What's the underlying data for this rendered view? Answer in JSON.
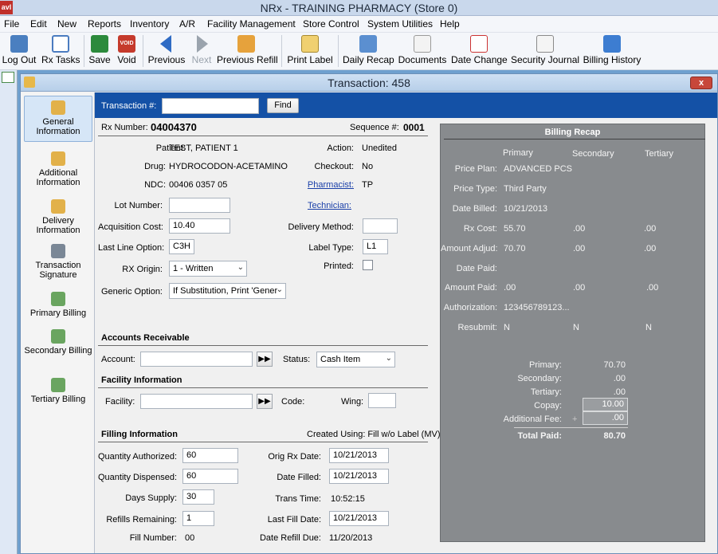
{
  "app": {
    "icon_text": "avl",
    "title": "NRx - TRAINING PHARMACY (Store 0)"
  },
  "menu": [
    "File",
    "Edit",
    "New",
    "Reports",
    "Inventory",
    "A/R",
    "Facility Management",
    "Store Control",
    "System Utilities",
    "Help"
  ],
  "toolbar": {
    "logout": "Log Out",
    "rxtasks": "Rx Tasks",
    "save": "Save",
    "void": "Void",
    "previous": "Previous",
    "next": "Next",
    "previous_refill": "Previous Refill",
    "print_label": "Print Label",
    "daily_recap": "Daily Recap",
    "documents": "Documents",
    "date_change": "Date Change",
    "security_journal": "Security Journal",
    "billing_history": "Billing History",
    "void_icon_text": "VOID"
  },
  "window": {
    "title": "Transaction: 458",
    "close": "x"
  },
  "nav": {
    "general": "General Information",
    "additional": "Additional Information",
    "delivery": "Delivery Information",
    "signature": "Transaction Signature",
    "primary": "Primary Billing",
    "secondary": "Secondary Billing",
    "tertiary": "Tertiary Billing"
  },
  "search": {
    "label": "Transaction #:",
    "value": "",
    "find": "Find"
  },
  "rx": {
    "number_label": "Rx Number:",
    "number": "04004370",
    "sequence_label": "Sequence #:",
    "sequence": "0001",
    "patient_label": "Patient:",
    "patient": "TEST, PATIENT 1",
    "drug_label": "Drug:",
    "drug": "HYDROCODON-ACETAMINO",
    "ndc_label": "NDC:",
    "ndc": "00406 0357 05",
    "lot_label": "Lot Number:",
    "lot": "",
    "acq_label": "Acquisition Cost:",
    "acq": "10.40",
    "lastline_label": "Last Line Option:",
    "lastline": "C3H",
    "origin_label": "RX Origin:",
    "origin": "1 - Written",
    "generic_label": "Generic Option:",
    "generic": "If Substitution, Print 'Gener",
    "action_label": "Action:",
    "action": "Unedited",
    "checkout_label": "Checkout:",
    "checkout": "No",
    "pharmacist_label": "Pharmacist:",
    "pharmacist": "TP",
    "technician_label": "Technician:",
    "delivery_label": "Delivery Method:",
    "delivery": "",
    "labeltype_label": "Label Type:",
    "labeltype": "L1",
    "printed_label": "Printed:"
  },
  "ar": {
    "heading": "Accounts Receivable",
    "account_label": "Account:",
    "account": "",
    "status_label": "Status:",
    "status": "Cash Item"
  },
  "facility": {
    "heading": "Facility Information",
    "facility_label": "Facility:",
    "facility": "",
    "code_label": "Code:",
    "wing_label": "Wing:",
    "wing": ""
  },
  "filling": {
    "heading": "Filling Information",
    "created": "Created Using: Fill w/o Label (MV)",
    "qty_auth_label": "Quantity Authorized:",
    "qty_auth": "60",
    "qty_disp_label": "Quantity Dispensed:",
    "qty_disp": "60",
    "days_label": "Days Supply:",
    "days": "30",
    "refills_label": "Refills Remaining:",
    "refills": "1",
    "fillnum_label": "Fill Number:",
    "fillnum": "00",
    "orig_label": "Orig Rx Date:",
    "orig": "10/21/2013",
    "filled_label": "Date Filled:",
    "filled": "10/21/2013",
    "trans_label": "Trans Time:",
    "trans": "10:52:15",
    "lastfill_label": "Last Fill Date:",
    "lastfill": "10/21/2013",
    "refilldue_label": "Date Refill Due:",
    "refilldue": "11/20/2013"
  },
  "recap": {
    "title": "Billing Recap",
    "cols": [
      "Primary",
      "Secondary",
      "Tertiary"
    ],
    "rows": [
      {
        "label": "Price Plan:",
        "p": "ADVANCED PCS",
        "s": "",
        "t": ""
      },
      {
        "label": "Price Type:",
        "p": "Third Party",
        "s": "",
        "t": ""
      },
      {
        "label": "Date Billed:",
        "p": "10/21/2013",
        "s": "",
        "t": ""
      },
      {
        "label": "Rx Cost:",
        "p": "55.70",
        "s": ".00",
        "t": ".00"
      },
      {
        "label": "Amount Adjud:",
        "p": "70.70",
        "s": ".00",
        "t": ".00"
      },
      {
        "label": "Date Paid:",
        "p": "",
        "s": "",
        "t": ""
      },
      {
        "label": "Amount Paid:",
        "p": ".00",
        "s": ".00",
        "t": ".00"
      },
      {
        "label": "Authorization:",
        "p": "123456789123...",
        "s": "",
        "t": ""
      },
      {
        "label": "Resubmit:",
        "p": "N",
        "s": "N",
        "t": "N"
      }
    ],
    "primary_label": "Primary:",
    "primary": "70.70",
    "secondary_label": "Secondary:",
    "secondary": ".00",
    "tertiary_label": "Tertiary:",
    "tertiary": ".00",
    "copay_label": "Copay:",
    "copay": "10.00",
    "addfee_label": "Additional Fee:",
    "addfee_sign": "+",
    "addfee": ".00",
    "total_label": "Total Paid:",
    "total": "80.70"
  },
  "colors": {
    "accent": "#1451a6",
    "recap_bg": "#888b8e",
    "link": "#1a3fa8"
  }
}
